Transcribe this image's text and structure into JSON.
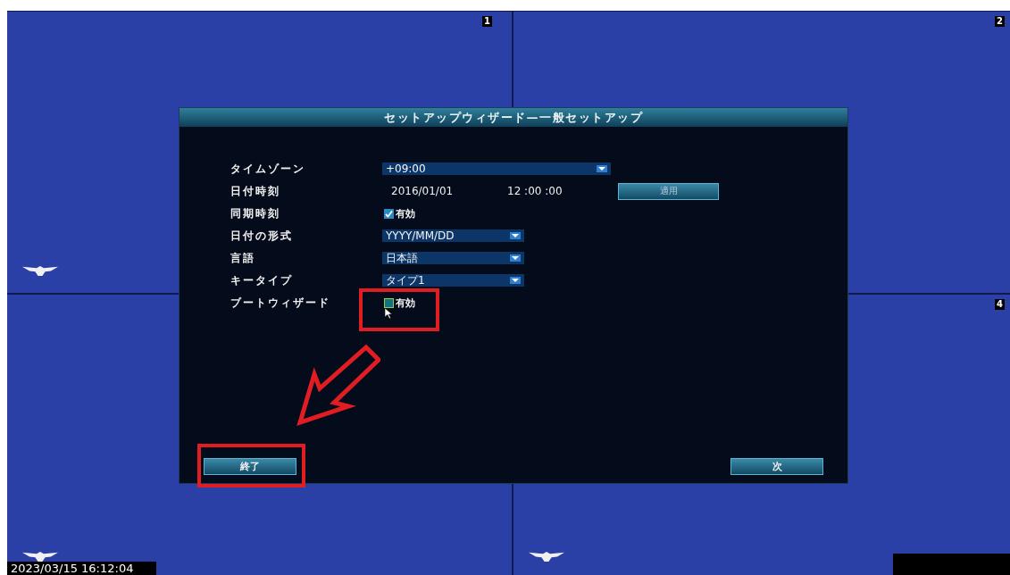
{
  "tiles": [
    {
      "channel_number": "1",
      "logo": true
    },
    {
      "channel_number": "2"
    },
    {
      "logo": true
    },
    {
      "channel_number": "4",
      "logo": true
    }
  ],
  "osd_time": "2023/03/15 16:12:04",
  "dialog": {
    "title": "セットアップウィザード—一般セットアップ",
    "fields": [
      {
        "kind": "dropdown",
        "label": "タイムゾーン",
        "value": "+09:00",
        "wide": true
      },
      {
        "kind": "datetime",
        "label": "日付時刻",
        "date": "2016/01/01",
        "time": "12 :00 :00",
        "button": "適用"
      },
      {
        "kind": "checkbox",
        "label": "同期時刻",
        "option": "有効",
        "checked": true
      },
      {
        "kind": "dropdown",
        "label": "日付の形式",
        "value": "YYYY/MM/DD",
        "wide": false
      },
      {
        "kind": "dropdown",
        "label": "言語",
        "value": "日本語",
        "wide": false
      },
      {
        "kind": "dropdown",
        "label": "キータイプ",
        "value": "タイプ1",
        "wide": false
      },
      {
        "kind": "checkbox",
        "label": "ブートウィザード",
        "option": "有効",
        "checked": false
      }
    ],
    "buttons": [
      "終了",
      "次"
    ]
  }
}
